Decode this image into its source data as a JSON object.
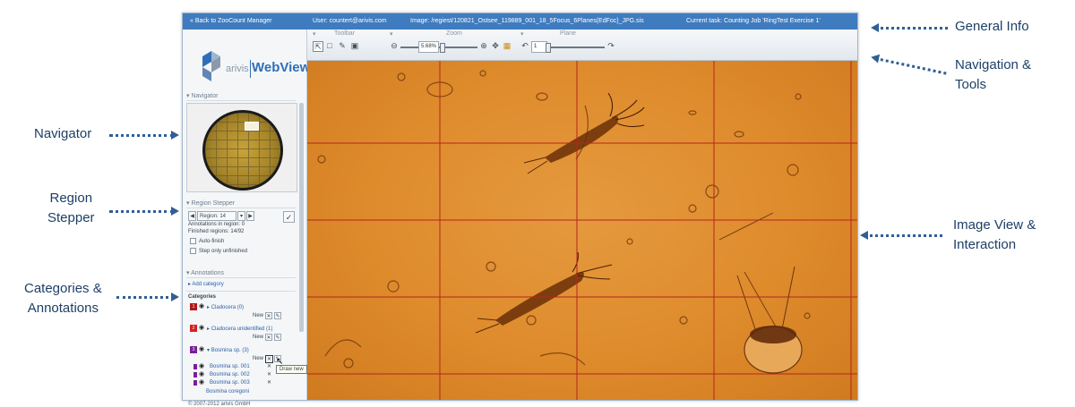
{
  "callouts": {
    "general_info": "General Info",
    "navigation_tools_line1": "Navigation &",
    "navigation_tools_line2": "Tools",
    "navigator": "Navigator",
    "region_stepper_line1": "Region",
    "region_stepper_line2": "Stepper",
    "categories_line1": "Categories &",
    "categories_line2": "Annotations",
    "image_view_line1": "Image View &",
    "image_view_line2": "Interaction"
  },
  "infobar": {
    "back_link": "« Back to ZooCount Manager",
    "user": "User: countert@arivis.com",
    "image": "Image: /regiest/120821_Ostsee_119889_001_18_5Focus_6Planes(EdFoc)_JPG.sis",
    "task": "Current task: Counting Job 'RingTest Exercise 1'"
  },
  "logo": {
    "brand": "arivis",
    "product": "WebView"
  },
  "navigator": {
    "title": "Navigator"
  },
  "region_stepper": {
    "title": "Region Stepper",
    "region_value": "Region: 14",
    "annotations_text": "Annotations in region: 0",
    "finished_text": "Finished regions: 14/92",
    "auto_finish": "Auto-finish",
    "step_unfinished": "Step only unfinished"
  },
  "annotations": {
    "title": "Annotations",
    "add_category": "Add category",
    "categories_label": "Categories",
    "new_label": "New",
    "draw_tooltip": "Draw new",
    "categories": [
      {
        "index": "1",
        "name": "Cladocera (0)",
        "color": "#b01818"
      },
      {
        "index": "2",
        "name": "Cladocera unidentified (1)",
        "color": "#d42020"
      },
      {
        "index": "3",
        "name": "Bosmina sp. (3)",
        "color": "#7a1e9a"
      }
    ],
    "items": [
      {
        "name": "Bosmina sp. 001"
      },
      {
        "name": "Bosmina sp. 002"
      },
      {
        "name": "Bosmina sp. 003"
      }
    ],
    "partial_category": "Bosmina coregoni"
  },
  "toolbar": {
    "toolbar_title": "Toolbar",
    "zoom_title": "Zoom",
    "zoom_value": "5.68%",
    "plane_title": "Plane",
    "plane_value": "1"
  },
  "footer": "© 2007-2012 arivis GmbH",
  "colors": {
    "infobar": "#3f7bbf",
    "brand_blue": "#2f6fb8",
    "specimen_orange": "#de8b2c",
    "grid_red": "#b8241c"
  }
}
